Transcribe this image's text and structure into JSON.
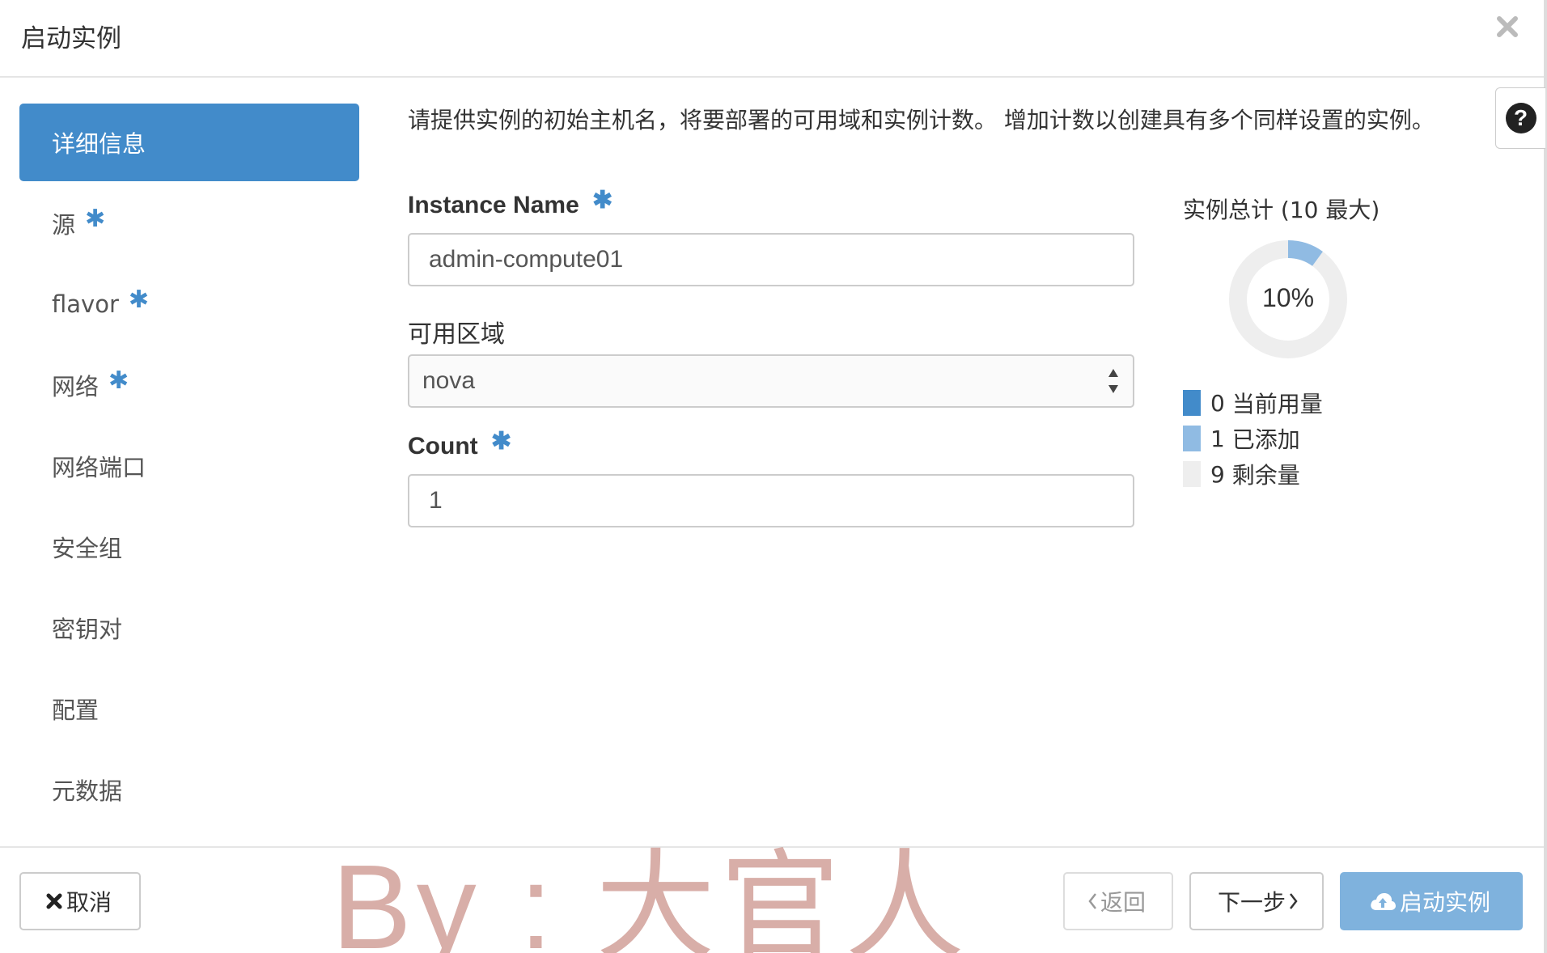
{
  "dialog": {
    "title": "启动实例"
  },
  "sidebar": {
    "items": [
      {
        "label": "详细信息",
        "required": false,
        "active": true
      },
      {
        "label": "源",
        "required": true,
        "active": false
      },
      {
        "label": "flavor",
        "required": true,
        "active": false
      },
      {
        "label": "网络",
        "required": true,
        "active": false
      },
      {
        "label": "网络端口",
        "required": false,
        "active": false
      },
      {
        "label": "安全组",
        "required": false,
        "active": false
      },
      {
        "label": "密钥对",
        "required": false,
        "active": false
      },
      {
        "label": "配置",
        "required": false,
        "active": false
      },
      {
        "label": "元数据",
        "required": false,
        "active": false
      }
    ],
    "required_marker": "✱"
  },
  "main": {
    "description": "请提供实例的初始主机名，将要部署的可用域和实例计数。 增加计数以创建具有多个同样设置的实例。",
    "instance_name": {
      "label": "Instance Name",
      "value": "admin-compute01"
    },
    "availability_zone": {
      "label": "可用区域",
      "value": "nova"
    },
    "count": {
      "label": "Count",
      "value": "1"
    }
  },
  "quota": {
    "title": "实例总计 (10 最大)",
    "percent_label": "10%",
    "current_fraction": 0.0,
    "added_fraction": 0.1,
    "legend": [
      {
        "value": "0",
        "label": "当前用量",
        "color": "#428bca"
      },
      {
        "value": "1",
        "label": "已添加",
        "color": "#90bbe3"
      },
      {
        "value": "9",
        "label": "剩余量",
        "color": "#eeeeee"
      }
    ]
  },
  "footer": {
    "cancel_label": "取消",
    "back_label": "返回",
    "next_label": "下一步",
    "launch_label": "启动实例"
  },
  "watermark": "By : 大官人",
  "colors": {
    "accent": "#428bca",
    "launch": "#7fb2dd",
    "border": "#cccccc"
  }
}
